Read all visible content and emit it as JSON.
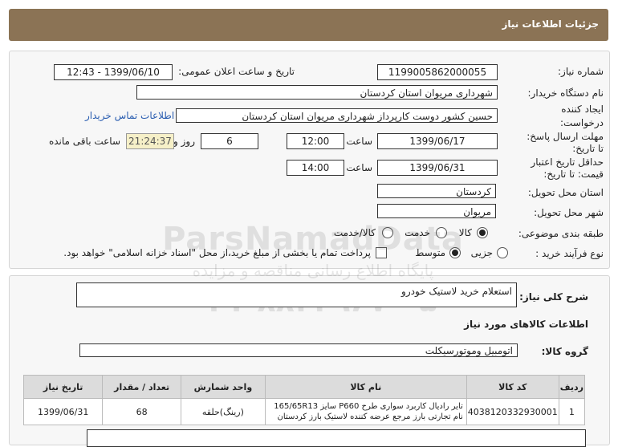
{
  "header": {
    "title": "جزئیات اطلاعات نیاز"
  },
  "fields": {
    "need_number_label": "شماره نیاز:",
    "need_number": "1199005862000055",
    "announce_label": "تاریخ و ساعت اعلان عمومی:",
    "announce_value": "1399/06/10 - 12:43",
    "buyer_label": "نام دستگاه خریدار:",
    "buyer_value": "شهرداری مریوان استان کردستان",
    "creator_label_1": "ایجاد کننده",
    "creator_label_2": "درخواست:",
    "creator_value": "حسین کشور دوست کارپرداز شهرداری مریوان استان کردستان",
    "contact_link": "اطلاعات تماس خریدار",
    "deadline_label_1": "مهلت ارسال پاسخ:",
    "deadline_label_2": "تا تاریخ:",
    "deadline_date": "1399/06/17",
    "hour_label": "ساعت",
    "deadline_time": "12:00",
    "days_value": "6",
    "days_label": "روز و",
    "remaining_time": "21:24:37",
    "remaining_label": "ساعت باقی مانده",
    "validity_label_1": "حداقل تاریخ اعتبار",
    "validity_label_2": "قیمت: تا تاریخ:",
    "validity_date": "1399/06/31",
    "validity_time": "14:00",
    "province_label": "استان محل تحویل:",
    "province_value": "کردستان",
    "city_label": "شهر محل تحویل:",
    "city_value": "مریوان",
    "category_label": "طبقه بندی موضوعی:",
    "category_options": [
      "کالا",
      "خدمت",
      "کالا/خدمت"
    ],
    "category_selected": "کالا",
    "process_label": "نوع فرآیند خرید :",
    "process_options": [
      "جزیی",
      "متوسط"
    ],
    "process_selected": "متوسط",
    "payment_note": "پرداخت تمام یا بخشی از مبلغ خرید،از محل \"اسناد خزانه اسلامی\" خواهد بود."
  },
  "summary": {
    "label": "شرح کلی نیاز:",
    "value": "استعلام خرید لاستیک خودرو"
  },
  "goods": {
    "section_title": "اطلاعات کالاهای مورد نیاز",
    "group_label": "گروه کالا:",
    "group_value": "اتومبیل وموتورسیکلت",
    "columns": [
      "ردیف",
      "کد کالا",
      "نام کالا",
      "واحد شمارش",
      "تعداد / مقدار",
      "تاریخ نیاز"
    ],
    "rows": [
      {
        "index": "1",
        "code": "4038120332930001",
        "name": "تایر رادیال کاربرد سواری طرح P660 سایز 165/65R13 نام تجارتی بارز مرجع عرضه کننده لاستیک بارز کردستان",
        "unit": "(رینگ)حلقه",
        "qty": "68",
        "date": "1399/06/31"
      }
    ]
  },
  "watermark": {
    "line1": "ParsNamadData",
    "line2": "پایگاه اطلاع رسانی مناقصه و مزایده",
    "line3": "۰۲۱-۸۸۳۴۹۶۷۰-۵"
  }
}
